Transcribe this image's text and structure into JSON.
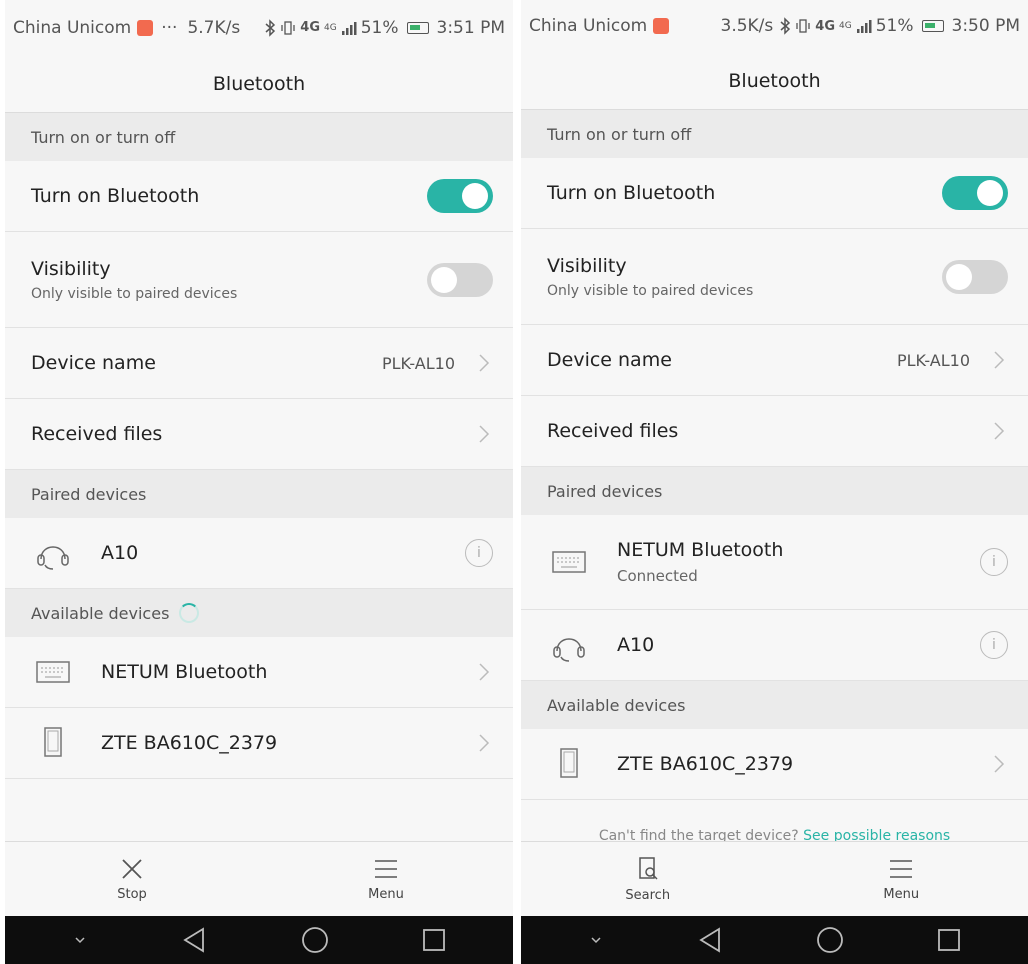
{
  "left": {
    "status": {
      "carrier": "China Unicom",
      "dots": "···",
      "speed": "5.7K/s",
      "net": "4G",
      "net_small": "4G",
      "battery": "51%",
      "time": "3:51 PM"
    },
    "title": "Bluetooth",
    "section_toggle": "Turn on or turn off",
    "bt_label": "Turn on Bluetooth",
    "vis_label": "Visibility",
    "vis_sub": "Only visible to paired devices",
    "devname_label": "Device name",
    "devname_value": "PLK-AL10",
    "received_label": "Received files",
    "section_paired": "Paired devices",
    "paired": [
      {
        "name": "A10",
        "icon": "headset-icon"
      }
    ],
    "section_available": "Available devices",
    "available": [
      {
        "name": "NETUM Bluetooth",
        "icon": "keyboard-icon"
      },
      {
        "name": "ZTE BA610C_2379",
        "icon": "phone-icon"
      }
    ],
    "bottom": {
      "btn1": "Stop",
      "btn2": "Menu"
    }
  },
  "right": {
    "status": {
      "carrier": "China Unicom",
      "speed": "3.5K/s",
      "net": "4G",
      "net_small": "4G",
      "battery": "51%",
      "time": "3:50 PM"
    },
    "title": "Bluetooth",
    "section_toggle": "Turn on or turn off",
    "bt_label": "Turn on Bluetooth",
    "vis_label": "Visibility",
    "vis_sub": "Only visible to paired devices",
    "devname_label": "Device name",
    "devname_value": "PLK-AL10",
    "received_label": "Received files",
    "section_paired": "Paired devices",
    "paired": [
      {
        "name": "NETUM Bluetooth",
        "sub": "Connected",
        "icon": "keyboard-icon"
      },
      {
        "name": "A10",
        "icon": "headset-icon"
      }
    ],
    "section_available": "Available devices",
    "available": [
      {
        "name": "ZTE BA610C_2379",
        "icon": "phone-icon"
      }
    ],
    "cantfind": "Can't find the target device? ",
    "cantfind_link": "See possible reasons",
    "bottom": {
      "btn1": "Search",
      "btn2": "Menu"
    }
  }
}
